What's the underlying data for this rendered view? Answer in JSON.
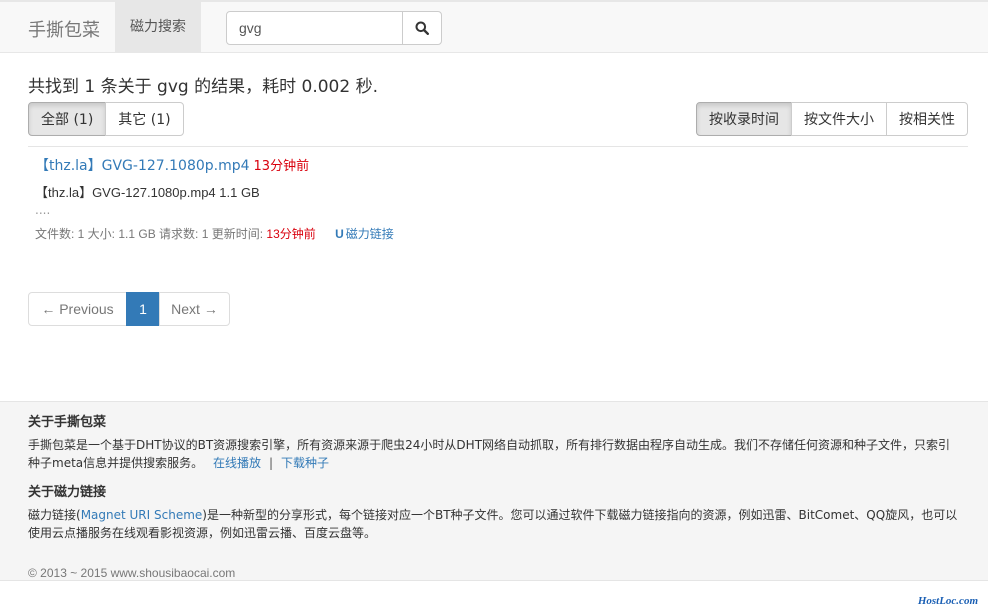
{
  "header": {
    "brand": "手撕包菜",
    "active_nav": "磁力搜索",
    "search_value": "gvg"
  },
  "summary": {
    "p1": "共找到 ",
    "count": "1",
    "p2": " 条关于 ",
    "keyword": "gvg",
    "p3": " 的结果，耗时 ",
    "time": "0.002",
    "p4": " 秒."
  },
  "filters": [
    {
      "label": "全部 (1)",
      "active": true
    },
    {
      "label": "其它 (1)",
      "active": false
    }
  ],
  "sort": [
    {
      "label": "按收录时间",
      "active": true
    },
    {
      "label": "按文件大小",
      "active": false
    },
    {
      "label": "按相关性",
      "active": false
    }
  ],
  "result": {
    "title": "【thz.la】GVG-127.1080p.mp4",
    "title_time": "13分钟前",
    "file_line": "【thz.la】GVG-127.1080p.mp4  1.1 GB",
    "ellipsis": "....",
    "meta_prefix": "文件数: 1 大小: 1.1 GB 请求数: 1 更新时间: ",
    "meta_time": "13分钟前",
    "magnet_label": "磁力链接"
  },
  "pagination": {
    "prev": "← Previous",
    "current": "1",
    "next": "Next →"
  },
  "footer": {
    "about_title": "关于手撕包菜",
    "about_text": "手撕包菜是一个基于DHT协议的BT资源搜索引擎，所有资源来源于爬虫24小时从DHT网络自动抓取，所有排行数据由程序自动生成。我们不存储任何资源和种子文件，只索引种子meta信息并提供搜索服务。",
    "online_play": "在线播放",
    "separator": "|",
    "download_seed": "下载种子",
    "magnet_title": "关于磁力链接",
    "magnet_text_a": "磁力链接(",
    "magnet_scheme": "Magnet URI Scheme",
    "magnet_text_b": ")是一种新型的分享形式，每个链接对应一个BT种子文件。您可以通过软件下载磁力链接指向的资源，例如迅雷、BitComet、QQ旋风，也可以使用云点播服务在线观看影视资源，例如迅雷云播、百度云盘等。",
    "copyright": "© 2013 ~ 2015 www.shousibaocai.com"
  },
  "watermark": "HostLoc.com"
}
